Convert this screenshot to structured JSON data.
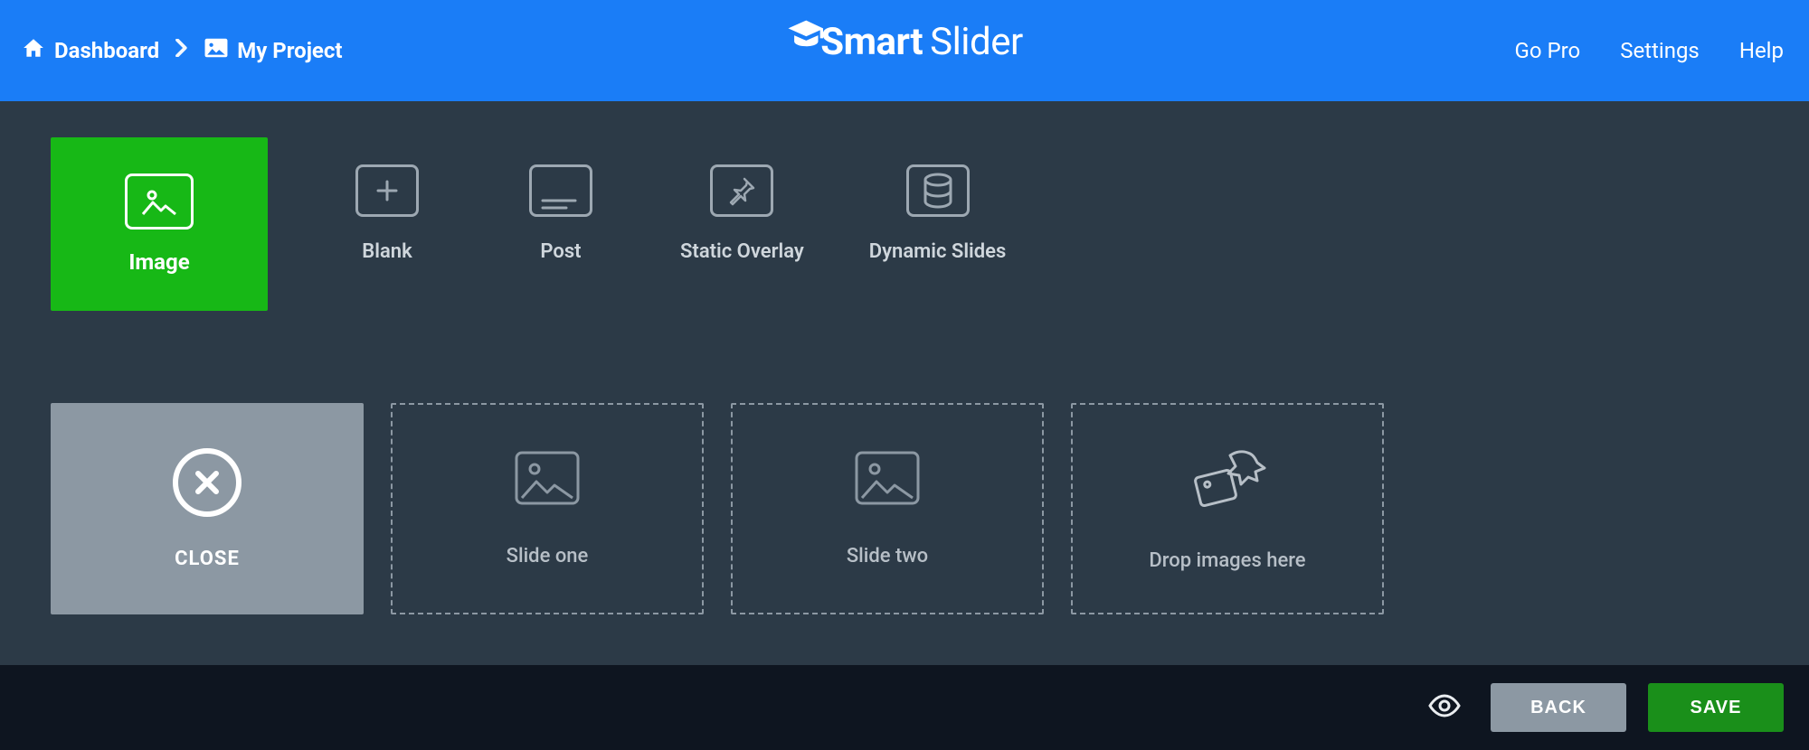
{
  "header": {
    "breadcrumb": {
      "home_label": "Dashboard",
      "project_label": "My Project"
    },
    "logo_text_1": "Smart",
    "logo_text_2": "Slider",
    "nav": {
      "go_pro": "Go Pro",
      "settings": "Settings",
      "help": "Help"
    }
  },
  "slide_types": [
    {
      "id": "image",
      "label": "Image",
      "active": true
    },
    {
      "id": "blank",
      "label": "Blank",
      "active": false
    },
    {
      "id": "post",
      "label": "Post",
      "active": false
    },
    {
      "id": "static-overlay",
      "label": "Static Overlay",
      "active": false
    },
    {
      "id": "dynamic-slides",
      "label": "Dynamic Slides",
      "active": false
    }
  ],
  "slides_row": {
    "close_label": "CLOSE",
    "items": [
      {
        "id": "slide-one",
        "label": "Slide one",
        "icon": "image"
      },
      {
        "id": "slide-two",
        "label": "Slide two",
        "icon": "image"
      },
      {
        "id": "drop",
        "label": "Drop images here",
        "icon": "drop"
      }
    ]
  },
  "footer": {
    "back_label": "BACK",
    "save_label": "SAVE"
  }
}
